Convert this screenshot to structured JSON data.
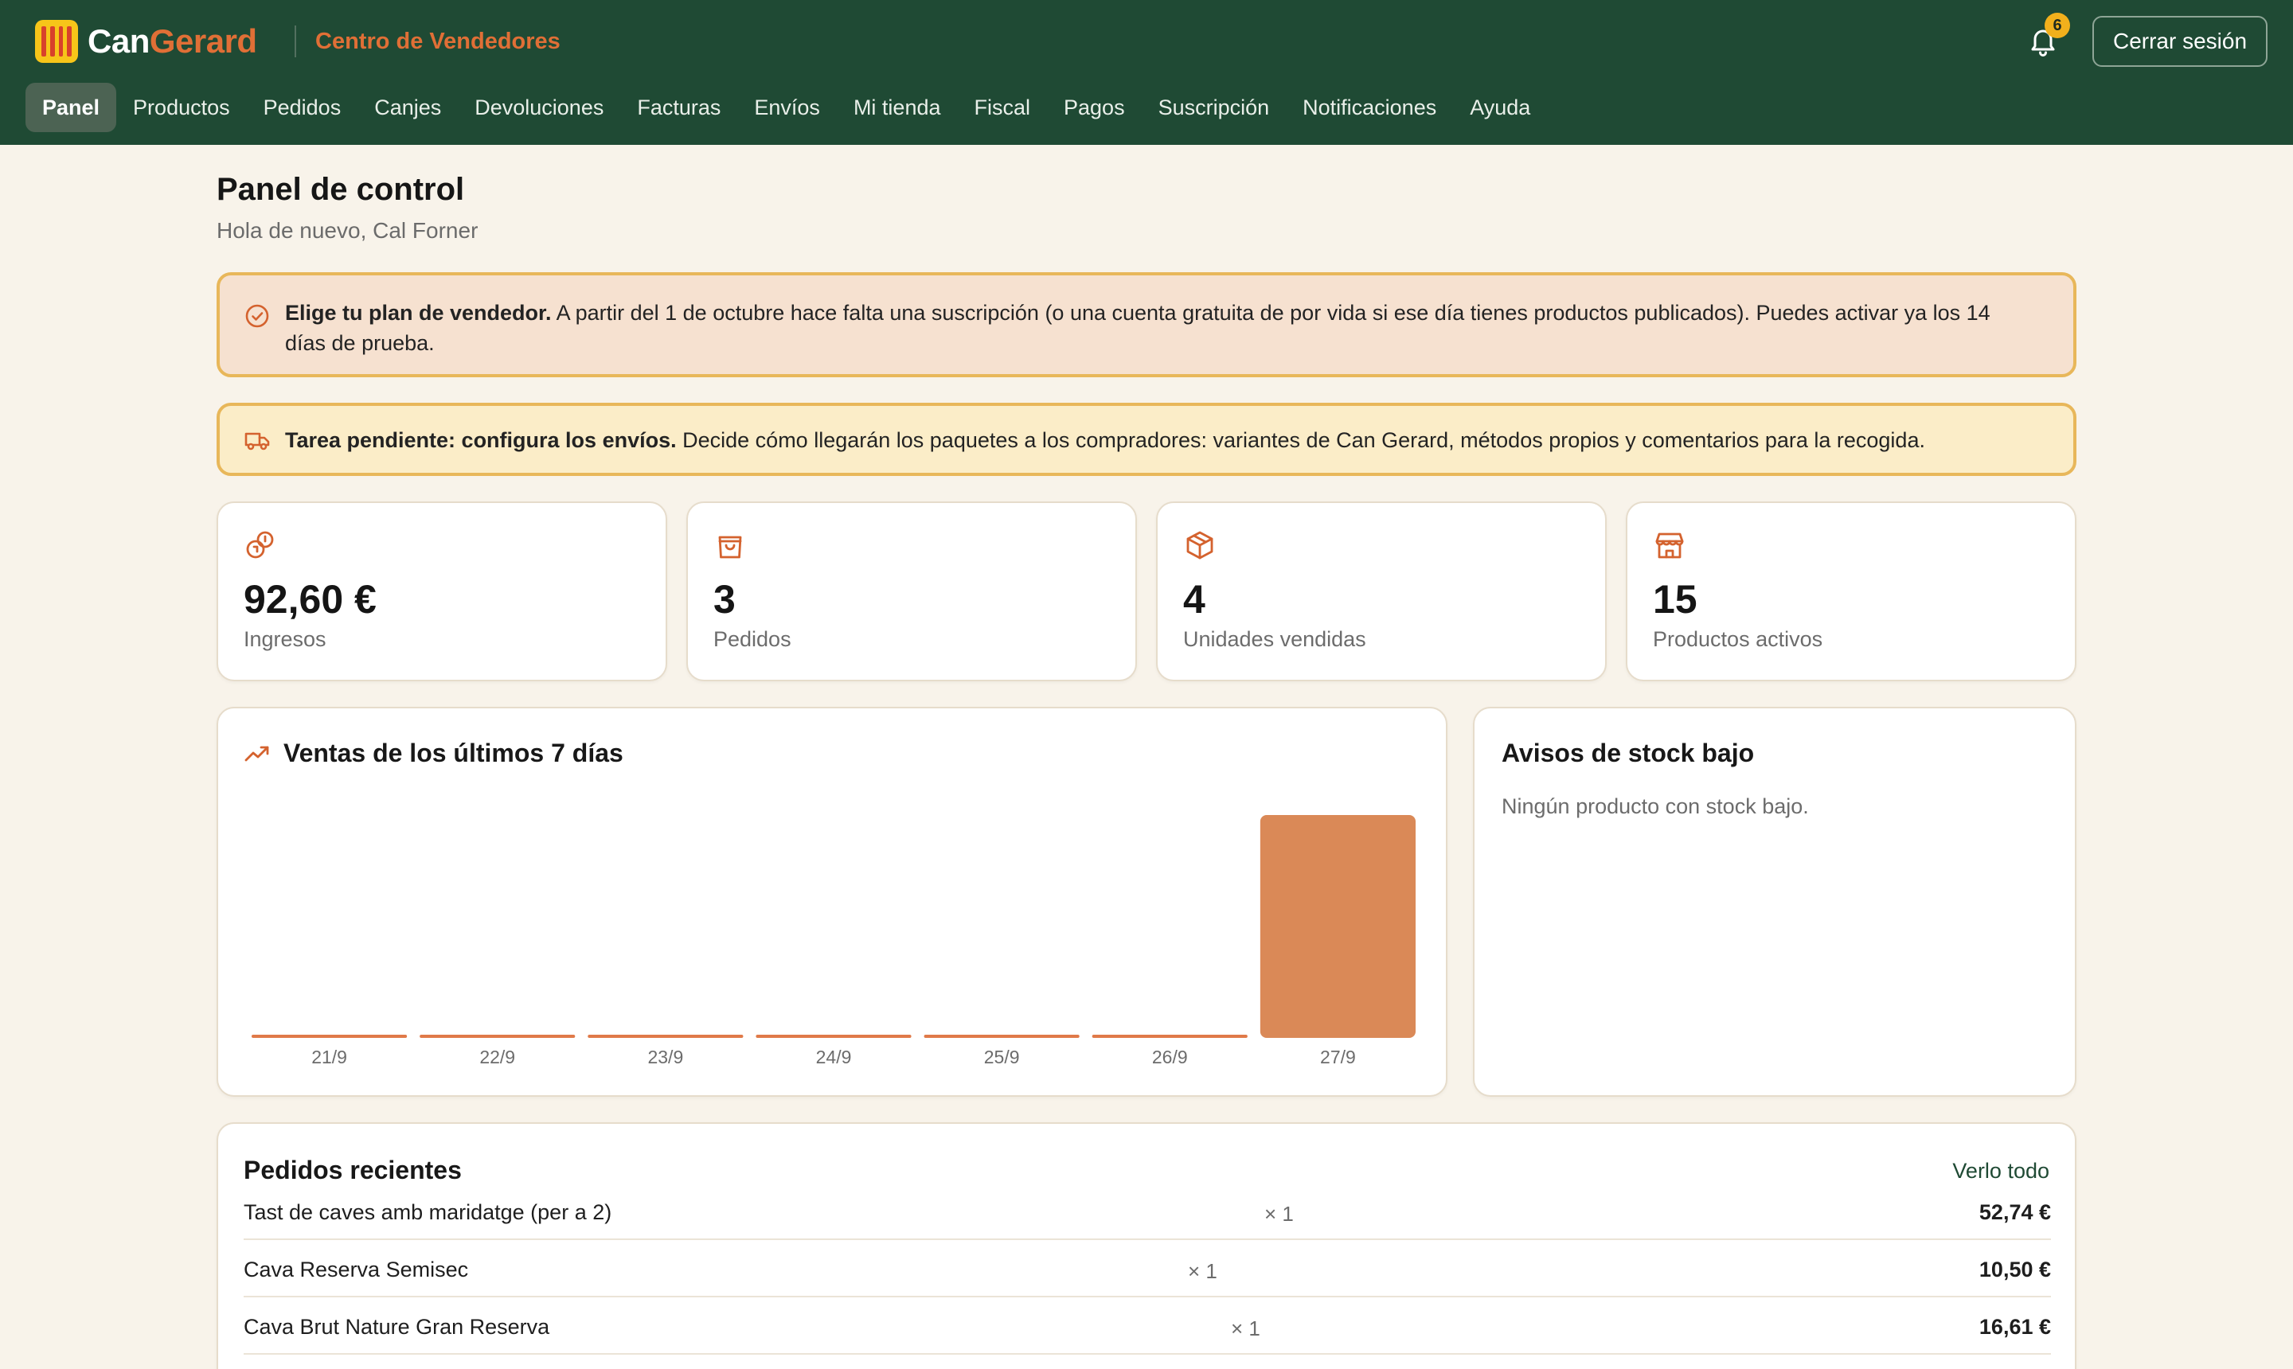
{
  "brand": {
    "part1": "Can",
    "part2": "Gerard",
    "portal": "Centro de Vendedores"
  },
  "header": {
    "notifications_count": "6",
    "logout_label": "Cerrar sesión"
  },
  "nav": [
    {
      "label": "Panel",
      "active": true
    },
    {
      "label": "Productos"
    },
    {
      "label": "Pedidos"
    },
    {
      "label": "Canjes"
    },
    {
      "label": "Devoluciones"
    },
    {
      "label": "Facturas"
    },
    {
      "label": "Envíos"
    },
    {
      "label": "Mi tienda"
    },
    {
      "label": "Fiscal"
    },
    {
      "label": "Pagos"
    },
    {
      "label": "Suscripción"
    },
    {
      "label": "Notificaciones"
    },
    {
      "label": "Ayuda"
    }
  ],
  "page": {
    "title": "Panel de control",
    "subtitle": "Hola de nuevo, Cal Forner"
  },
  "alerts": {
    "plan": {
      "title": "Elige tu plan de vendedor.",
      "text": "A partir del 1 de octubre hace falta una suscripción (o una cuenta gratuita de por vida si ese día tienes productos publicados). Puedes activar ya los 14 días de prueba."
    },
    "shipping": {
      "title": "Tarea pendiente: configura los envíos.",
      "text": "Decide cómo llegarán los paquetes a los compradores: variantes de Can Gerard, métodos propios y comentarios para la recogida."
    }
  },
  "stats": [
    {
      "icon": "coins-icon",
      "value": "92,60 €",
      "label": "Ingresos"
    },
    {
      "icon": "shopping-bag-icon",
      "value": "3",
      "label": "Pedidos"
    },
    {
      "icon": "package-icon",
      "value": "4",
      "label": "Unidades vendidas"
    },
    {
      "icon": "store-icon",
      "value": "15",
      "label": "Productos activos"
    }
  ],
  "sales_chart": {
    "title": "Ventas de los últimos 7 días"
  },
  "chart_data": {
    "type": "bar",
    "title": "Ventas de los últimos 7 días",
    "categories": [
      "21/9",
      "22/9",
      "23/9",
      "24/9",
      "25/9",
      "26/9",
      "27/9"
    ],
    "values": [
      0,
      0,
      0,
      0,
      0,
      0,
      92.6
    ],
    "ylim": [
      0,
      92.6
    ],
    "grid": false,
    "colors": {
      "bar": "#da8957",
      "baseline": "#e07a49"
    }
  },
  "stock": {
    "title": "Avisos de stock bajo",
    "empty_text": "Ningún producto con stock bajo."
  },
  "orders": {
    "title": "Pedidos recientes",
    "view_all": "Verlo todo",
    "rows": [
      {
        "name": "Tast de caves amb maridatge (per a 2)",
        "qty": "× 1",
        "total": "52,74 €"
      },
      {
        "name": "Cava Reserva Semisec",
        "qty": "× 1",
        "total": "10,50 €"
      },
      {
        "name": "Cava Brut Nature Gran Reserva",
        "qty": "× 1",
        "total": "16,61 €"
      }
    ]
  },
  "colors": {
    "header": "#1f4a34",
    "accent": "#e06f36",
    "background": "#f8f3ea",
    "badge": "#f2b01c"
  }
}
